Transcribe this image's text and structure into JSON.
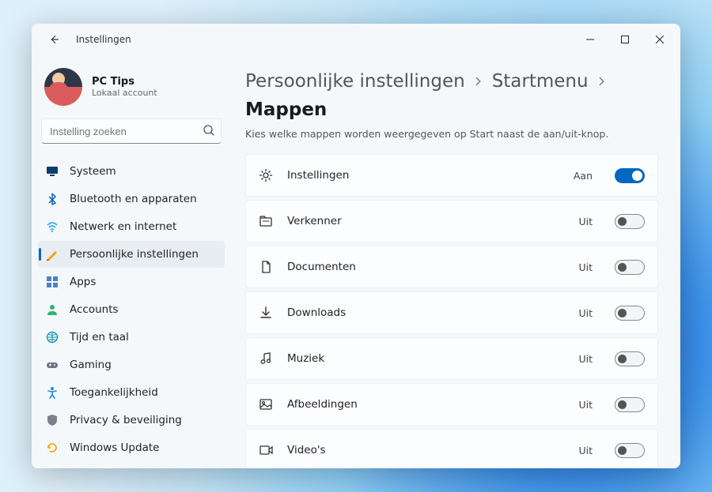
{
  "window": {
    "title": "Instellingen"
  },
  "profile": {
    "name": "PC Tips",
    "type": "Lokaal account"
  },
  "search": {
    "placeholder": "Instelling zoeken"
  },
  "sidebar": {
    "items": [
      {
        "id": "system",
        "label": "Systeem",
        "icon": "monitor",
        "selected": false
      },
      {
        "id": "bluetooth",
        "label": "Bluetooth en apparaten",
        "icon": "bluetooth",
        "selected": false
      },
      {
        "id": "network",
        "label": "Netwerk en internet",
        "icon": "wifi",
        "selected": false
      },
      {
        "id": "personalization",
        "label": "Persoonlijke instellingen",
        "icon": "paint",
        "selected": true
      },
      {
        "id": "apps",
        "label": "Apps",
        "icon": "grid",
        "selected": false
      },
      {
        "id": "accounts",
        "label": "Accounts",
        "icon": "person",
        "selected": false
      },
      {
        "id": "time",
        "label": "Tijd en taal",
        "icon": "globe",
        "selected": false
      },
      {
        "id": "gaming",
        "label": "Gaming",
        "icon": "gamepad",
        "selected": false
      },
      {
        "id": "accessibility",
        "label": "Toegankelijkheid",
        "icon": "accessibility",
        "selected": false
      },
      {
        "id": "privacy",
        "label": "Privacy & beveiliging",
        "icon": "shield",
        "selected": false
      },
      {
        "id": "update",
        "label": "Windows Update",
        "icon": "update",
        "selected": false
      }
    ]
  },
  "breadcrumb": {
    "parts": [
      "Persoonlijke instellingen",
      "Startmenu",
      "Mappen"
    ]
  },
  "subtitle": "Kies welke mappen worden weergegeven op Start naast de aan/uit-knop.",
  "state_labels": {
    "on": "Aan",
    "off": "Uit"
  },
  "folders": [
    {
      "id": "settings",
      "label": "Instellingen",
      "icon": "gear",
      "on": true
    },
    {
      "id": "explorer",
      "label": "Verkenner",
      "icon": "folder",
      "on": false
    },
    {
      "id": "documents",
      "label": "Documenten",
      "icon": "document",
      "on": false
    },
    {
      "id": "downloads",
      "label": "Downloads",
      "icon": "download",
      "on": false
    },
    {
      "id": "music",
      "label": "Muziek",
      "icon": "music",
      "on": false
    },
    {
      "id": "pictures",
      "label": "Afbeeldingen",
      "icon": "picture",
      "on": false
    },
    {
      "id": "videos",
      "label": "Video's",
      "icon": "video",
      "on": false
    }
  ]
}
